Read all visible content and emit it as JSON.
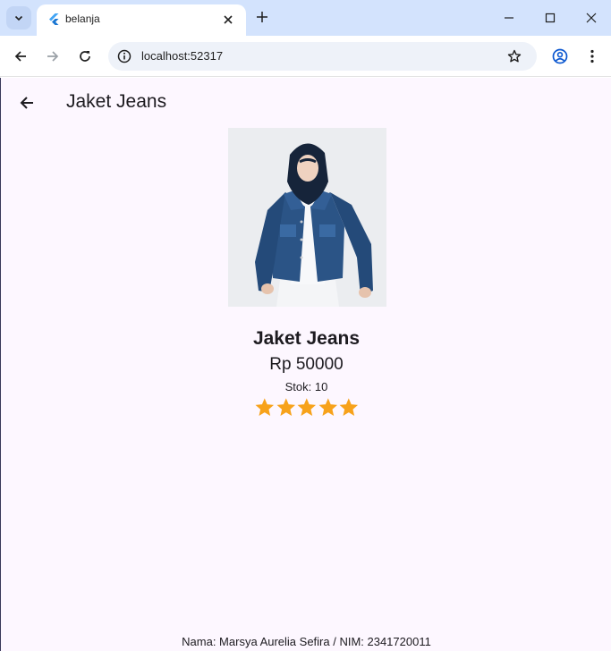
{
  "browser": {
    "tab_title": "belanja",
    "url": "localhost:52317"
  },
  "appbar": {
    "title": "Jaket Jeans"
  },
  "product": {
    "name": "Jaket Jeans",
    "price": "Rp 50000",
    "stock": "Stok: 10",
    "rating": 5,
    "rating_max": 5,
    "star_color": "#f7a21b"
  },
  "footer": {
    "text": "Nama: Marsya Aurelia Sefira / NIM: 2341720011"
  },
  "colors": {
    "tabstrip": "#d3e3fd",
    "app_background": "#fdf7ff"
  }
}
